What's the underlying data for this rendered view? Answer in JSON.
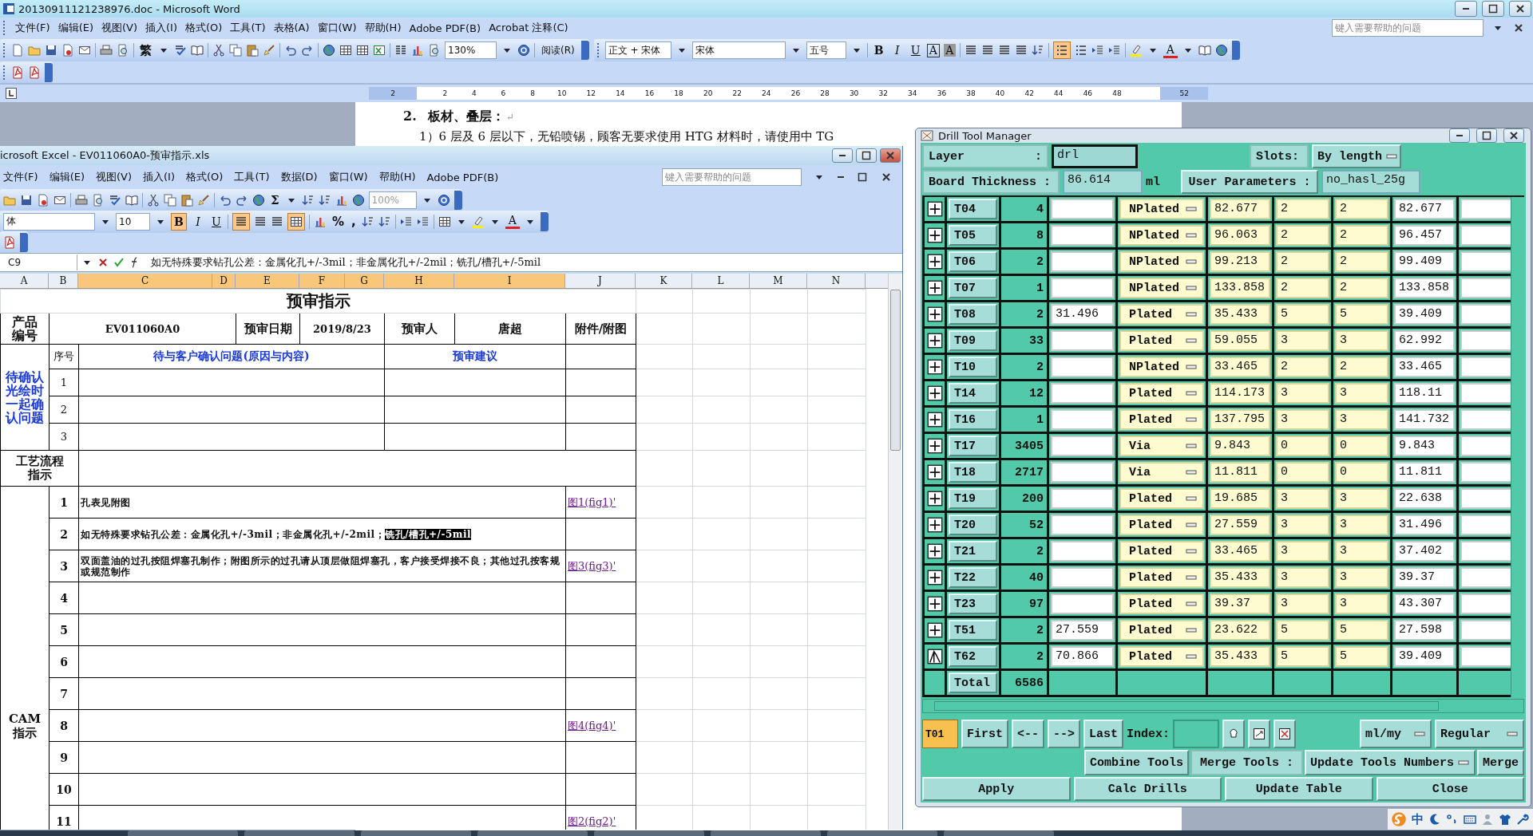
{
  "word": {
    "title": "20130911121238976.doc - Microsoft Word",
    "menus": [
      "文件(F)",
      "编辑(E)",
      "视图(V)",
      "插入(I)",
      "格式(O)",
      "工具(T)",
      "表格(A)",
      "窗口(W)",
      "帮助(H)",
      "Adobe PDF(B)",
      "Acrobat 注释(C)"
    ],
    "help_placeholder": "键入需要帮助的问题",
    "toolbar": {
      "convert": "繁",
      "zoom": "130%",
      "reading": "阅读(R)"
    },
    "format_toolbar": {
      "style": "正文 + 宋体",
      "font": "宋体",
      "size": "五号",
      "bold": "B",
      "italic": "I",
      "underline": "U",
      "border": "A",
      "shading": "A",
      "font_color": "A",
      "numbering_on": true
    },
    "ruler": [
      {
        "label": "2",
        "kind": "margin"
      },
      {
        "label": "2",
        "kind": "body"
      },
      {
        "label": "4",
        "kind": "body"
      },
      {
        "label": "6",
        "kind": "body"
      },
      {
        "label": "8",
        "kind": "body"
      },
      {
        "label": "10",
        "kind": "body"
      },
      {
        "label": "12",
        "kind": "body"
      },
      {
        "label": "14",
        "kind": "body"
      },
      {
        "label": "16",
        "kind": "body"
      },
      {
        "label": "18",
        "kind": "body"
      },
      {
        "label": "20",
        "kind": "body"
      },
      {
        "label": "22",
        "kind": "body"
      },
      {
        "label": "24",
        "kind": "body"
      },
      {
        "label": "26",
        "kind": "body"
      },
      {
        "label": "28",
        "kind": "body"
      },
      {
        "label": "30",
        "kind": "body"
      },
      {
        "label": "32",
        "kind": "body"
      },
      {
        "label": "34",
        "kind": "body"
      },
      {
        "label": "36",
        "kind": "body"
      },
      {
        "label": "38",
        "kind": "body"
      },
      {
        "label": "40",
        "kind": "body"
      },
      {
        "label": "42",
        "kind": "body"
      },
      {
        "label": "44",
        "kind": "body"
      },
      {
        "label": "46",
        "kind": "body"
      },
      {
        "label": "48",
        "kind": "body"
      },
      {
        "label": "52",
        "kind": "margin"
      }
    ],
    "document": {
      "heading_number": "2.",
      "heading": "板材、叠层：",
      "paragraph_mark": "↵",
      "paragraph": "1）6 层及 6 层以下，无铅喷锡，顾客无要求使用 HTG 材料时，请使用中 TG"
    }
  },
  "excel": {
    "title": "icrosoft Excel - EV011060A0-预审指示.xls",
    "menus": [
      "文件(F)",
      "编辑(E)",
      "视图(V)",
      "插入(I)",
      "格式(O)",
      "工具(T)",
      "数据(D)",
      "窗口(W)",
      "帮助(H)",
      "Adobe PDF(B)"
    ],
    "help_placeholder": "键入需要帮助的问题",
    "toolbar": {
      "sum": "Σ",
      "zoom": "100%"
    },
    "format_toolbar": {
      "font": "体",
      "size": "10",
      "bold": "B",
      "italic": "I",
      "underline": "U",
      "percent": "%",
      "comma": ",",
      "font_color": "A",
      "bold_on": true,
      "align_left_on": true,
      "merge_on": true
    },
    "name_box": "C9",
    "formula": "如无特殊要求钻孔公差：金属化孔+/-3mil；非金属化孔+/-2mil；铣孔/槽孔+/-5mil",
    "columns": [
      {
        "label": "A",
        "selected": false
      },
      {
        "label": "B",
        "selected": false
      },
      {
        "label": "C",
        "selected": true
      },
      {
        "label": "D",
        "selected": true
      },
      {
        "label": "E",
        "selected": true
      },
      {
        "label": "F",
        "selected": true
      },
      {
        "label": "G",
        "selected": true
      },
      {
        "label": "H",
        "selected": true
      },
      {
        "label": "I",
        "selected": true
      },
      {
        "label": "J",
        "selected": false
      },
      {
        "label": "K",
        "selected": false
      },
      {
        "label": "L",
        "selected": false
      },
      {
        "label": "M",
        "selected": false
      },
      {
        "label": "N",
        "selected": false
      }
    ],
    "sheet": {
      "title": "预审指示",
      "product": {
        "label": "产品编号",
        "number": "EV011060A0",
        "date_label": "预审日期",
        "date": "2019/8/23",
        "reviewer_label": "预审人",
        "reviewer": "唐超",
        "attachment_label": "附件/附图"
      },
      "confirm": {
        "label": "待确认光绘时一起确认问题",
        "no_header": "序号",
        "question_header": "待与客户确认问题(原因与内容)",
        "advice_header": "预审建议",
        "rows": [
          "1",
          "2",
          "3"
        ]
      },
      "process_label": "工艺流程指示",
      "cam": {
        "label": "CAM 指示",
        "rows": [
          {
            "no": "1",
            "text": "孔表见附图",
            "link": "图1(fig1)'"
          },
          {
            "no": "2",
            "text": "如无特殊要求钻孔公差：金属化孔+/-3mil；非金属化孔+/-2mil；",
            "selected_text": "铣孔/槽孔+/-5mil"
          },
          {
            "no": "3",
            "text": "双面盖油的过孔按阻焊塞孔制作；附图所示的过孔请从顶层做阻焊塞孔，客户接受焊接不良；其他过孔按客规或规范制作",
            "link": "图3(fig3)'"
          },
          {
            "no": "4"
          },
          {
            "no": "5"
          },
          {
            "no": "6"
          },
          {
            "no": "7"
          },
          {
            "no": "8",
            "link": "图4(fig4)'"
          },
          {
            "no": "9"
          },
          {
            "no": "10"
          },
          {
            "no": "11",
            "link": "图2(fig2)'"
          }
        ]
      }
    }
  },
  "drill_manager": {
    "title": "Drill Tool Manager",
    "layer_label": "Layer",
    "layer_colon": ":",
    "layer": "drl",
    "slots_label": "Slots:",
    "slots": "By length",
    "thickness_label": "Board Thickness :",
    "thickness": "86.614",
    "thickness_unit": "ml",
    "user_parameters_button": "User Parameters :",
    "user_parameters": "no_hasl_25g",
    "tools": [
      {
        "kind": "plus",
        "tool": "T04",
        "count": "4",
        "type": "NPlated",
        "column_5": "82.677",
        "column_6": "2",
        "column_7": "2",
        "column_8": "82.677"
      },
      {
        "kind": "plus",
        "tool": "T05",
        "count": "8",
        "type": "NPlated",
        "column_5": "96.063",
        "column_6": "2",
        "column_7": "2",
        "column_8": "96.457"
      },
      {
        "kind": "plus",
        "tool": "T06",
        "count": "2",
        "type": "NPlated",
        "column_5": "99.213",
        "column_6": "2",
        "column_7": "2",
        "column_8": "99.409"
      },
      {
        "kind": "plus",
        "tool": "T07",
        "count": "1",
        "type": "NPlated",
        "column_5": "133.858",
        "column_6": "2",
        "column_7": "2",
        "column_8": "133.858"
      },
      {
        "kind": "plus",
        "tool": "T08",
        "count": "2",
        "column_3": "31.496",
        "type": "Plated",
        "column_5": "35.433",
        "column_6": "5",
        "column_7": "5",
        "column_8": "39.409"
      },
      {
        "kind": "plus",
        "tool": "T09",
        "count": "33",
        "type": "Plated",
        "column_5": "59.055",
        "column_6": "3",
        "column_7": "3",
        "column_8": "62.992"
      },
      {
        "kind": "plus",
        "tool": "T10",
        "count": "2",
        "type": "NPlated",
        "column_5": "33.465",
        "column_6": "2",
        "column_7": "2",
        "column_8": "33.465"
      },
      {
        "kind": "plus",
        "tool": "T14",
        "count": "12",
        "type": "Plated",
        "column_5": "114.173",
        "column_6": "3",
        "column_7": "3",
        "column_8": "118.11"
      },
      {
        "kind": "plus",
        "tool": "T16",
        "count": "1",
        "type": "Plated",
        "column_5": "137.795",
        "column_6": "3",
        "column_7": "3",
        "column_8": "141.732"
      },
      {
        "kind": "plus",
        "tool": "T17",
        "count": "3405",
        "type": "Via",
        "column_5": "9.843",
        "column_6": "0",
        "column_7": "0",
        "column_8": "9.843"
      },
      {
        "kind": "plus",
        "tool": "T18",
        "count": "2717",
        "type": "Via",
        "column_5": "11.811",
        "column_6": "0",
        "column_7": "0",
        "column_8": "11.811"
      },
      {
        "kind": "plus",
        "tool": "T19",
        "count": "200",
        "type": "Plated",
        "column_5": "19.685",
        "column_6": "3",
        "column_7": "3",
        "column_8": "22.638"
      },
      {
        "kind": "plus",
        "tool": "T20",
        "count": "52",
        "type": "Plated",
        "column_5": "27.559",
        "column_6": "3",
        "column_7": "3",
        "column_8": "31.496"
      },
      {
        "kind": "plus",
        "tool": "T21",
        "count": "2",
        "type": "Plated",
        "column_5": "33.465",
        "column_6": "3",
        "column_7": "3",
        "column_8": "37.402"
      },
      {
        "kind": "plus",
        "tool": "T22",
        "count": "40",
        "type": "Plated",
        "column_5": "35.433",
        "column_6": "3",
        "column_7": "3",
        "column_8": "39.37"
      },
      {
        "kind": "plus",
        "tool": "T23",
        "count": "97",
        "type": "Plated",
        "column_5": "39.37",
        "column_6": "3",
        "column_7": "3",
        "column_8": "43.307"
      },
      {
        "kind": "plus",
        "tool": "T51",
        "count": "2",
        "column_3": "27.559",
        "type": "Plated",
        "column_5": "23.622",
        "column_6": "5",
        "column_7": "5",
        "column_8": "27.598"
      },
      {
        "kind": "peak",
        "tool": "T62",
        "count": "2",
        "column_3": "70.866",
        "type": "Plated",
        "column_5": "35.433",
        "column_6": "5",
        "column_7": "5",
        "column_8": "39.409"
      }
    ],
    "total_label": "Total",
    "total": "6586",
    "current_tool": "T01",
    "nav_buttons": [
      "First",
      "<--",
      "-->",
      "Last"
    ],
    "index_label": "Index:",
    "units": "ml/my",
    "mode": "Regular",
    "combine_button": "Combine Tools",
    "merge_label": "Merge Tools :",
    "merge_option": "Update Tools Numbers",
    "merge_button": "Merge",
    "actions": [
      "Apply",
      "Calc Drills",
      "Update Table",
      "Close"
    ]
  },
  "language_bar": {
    "mode": "中"
  }
}
